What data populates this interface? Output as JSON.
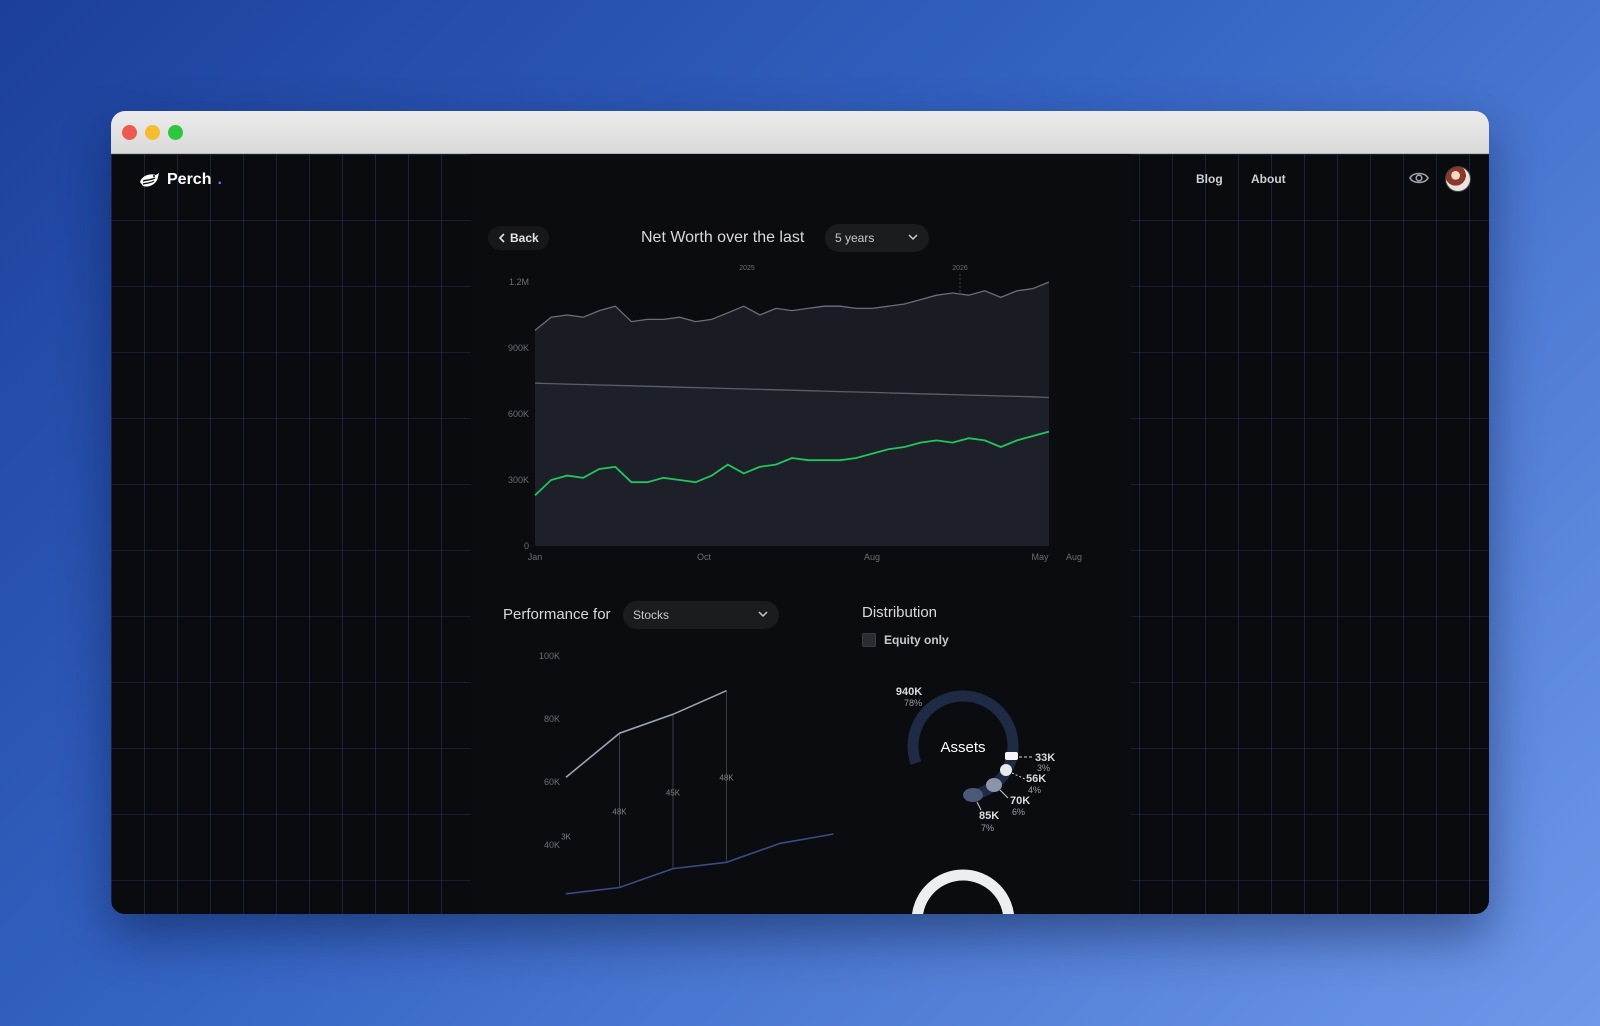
{
  "nav": {
    "brand": "Perch",
    "brand_dot": ".",
    "links": [
      "Blog",
      "About"
    ]
  },
  "header": {
    "back_label": "Back",
    "title": "Net Worth over the last",
    "period_select": "5 years"
  },
  "chart_data": [
    {
      "type": "area",
      "title": "Net Worth over the last 5 years",
      "y_ticks": [
        "0",
        "300K",
        "600K",
        "900K",
        "1.2M"
      ],
      "x_ticks": [
        "Jan",
        "Oct",
        "Aug",
        "May",
        "Aug"
      ],
      "top_ticks": [
        "2025",
        "2026"
      ],
      "ylim": [
        0,
        1200000
      ],
      "series": [
        {
          "values": [
            980000,
            1040000,
            1050000,
            1040000,
            1070000,
            1090000,
            1020000,
            1030000,
            1030000,
            1040000,
            1020000,
            1030000,
            1060000,
            1090000,
            1050000,
            1080000,
            1070000,
            1080000,
            1090000,
            1090000,
            1080000,
            1080000,
            1090000,
            1100000,
            1120000,
            1140000,
            1150000,
            1140000,
            1160000,
            1130000,
            1160000,
            1170000,
            1200000
          ]
        },
        {
          "values": [
            740000,
            738000,
            736000,
            734000,
            732000,
            730000,
            728000,
            726000,
            724000,
            722000,
            720000,
            718000,
            716000,
            714000,
            712000,
            710000,
            708000,
            706000,
            704000,
            702000,
            700000,
            698000,
            696000,
            694000,
            692000,
            690000,
            688000,
            686000,
            684000,
            682000,
            680000,
            678000,
            675000
          ],
          "color": "#6b7280"
        },
        {
          "values": [
            230000,
            300000,
            320000,
            310000,
            350000,
            360000,
            290000,
            290000,
            310000,
            300000,
            290000,
            320000,
            370000,
            330000,
            360000,
            370000,
            400000,
            390000,
            390000,
            390000,
            400000,
            420000,
            440000,
            450000,
            470000,
            480000,
            470000,
            490000,
            480000,
            450000,
            480000,
            500000,
            520000
          ],
          "color": "#22c55e"
        }
      ]
    },
    {
      "type": "line",
      "title": "Performance for Stocks",
      "y_ticks": [
        "40K",
        "60K",
        "80K",
        "100K"
      ],
      "ylim": [
        40000,
        100000
      ],
      "point_labels": [
        "3K",
        "48K",
        "45K",
        "48K"
      ],
      "series": [
        {
          "x": [
            0,
            1,
            2,
            3
          ],
          "values": [
            61500,
            75500,
            81500,
            89000
          ],
          "color": "#9aa4b8"
        },
        {
          "x": [
            0,
            1,
            2,
            3,
            4,
            5
          ],
          "values": [
            24500,
            26500,
            32500,
            34500,
            40500,
            43500
          ],
          "color": "#3a4c84"
        }
      ]
    },
    {
      "type": "pie",
      "title": "Distribution",
      "center_label": "Assets",
      "slices": [
        {
          "value": "940K",
          "pct": "78%"
        },
        {
          "value": "33K",
          "pct": "3%"
        },
        {
          "value": "56K",
          "pct": "4%"
        },
        {
          "value": "70K",
          "pct": "6%"
        },
        {
          "value": "85K",
          "pct": "7%"
        }
      ]
    }
  ],
  "performance": {
    "title": "Performance for",
    "select": "Stocks"
  },
  "distribution": {
    "title": "Distribution",
    "equity_label": "Equity only"
  },
  "colors": {
    "accent_green": "#22c55e",
    "brand_blue": "#4f86ff",
    "background": "#0a0b0e"
  }
}
